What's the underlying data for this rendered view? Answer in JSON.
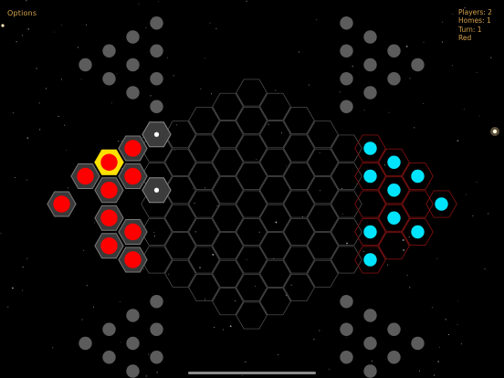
{
  "menu": {
    "options_label": "Options"
  },
  "status": {
    "players": "Players: 2",
    "homes": "Homes: 1",
    "turn": "Turn: 1",
    "current_player": "Red"
  },
  "colors": {
    "background": "#000000",
    "text": "#d4a24a",
    "grid_line": "#5a5a5a",
    "red_piece": "#ff0000",
    "cyan_piece": "#00e5ff",
    "selection_ring": "#ffe000",
    "inactive_home_dot": "#5c5c5c"
  },
  "board": {
    "red_pieces": 10,
    "cyan_pieces": 10,
    "selected_piece": "red",
    "move_targets": 2
  }
}
